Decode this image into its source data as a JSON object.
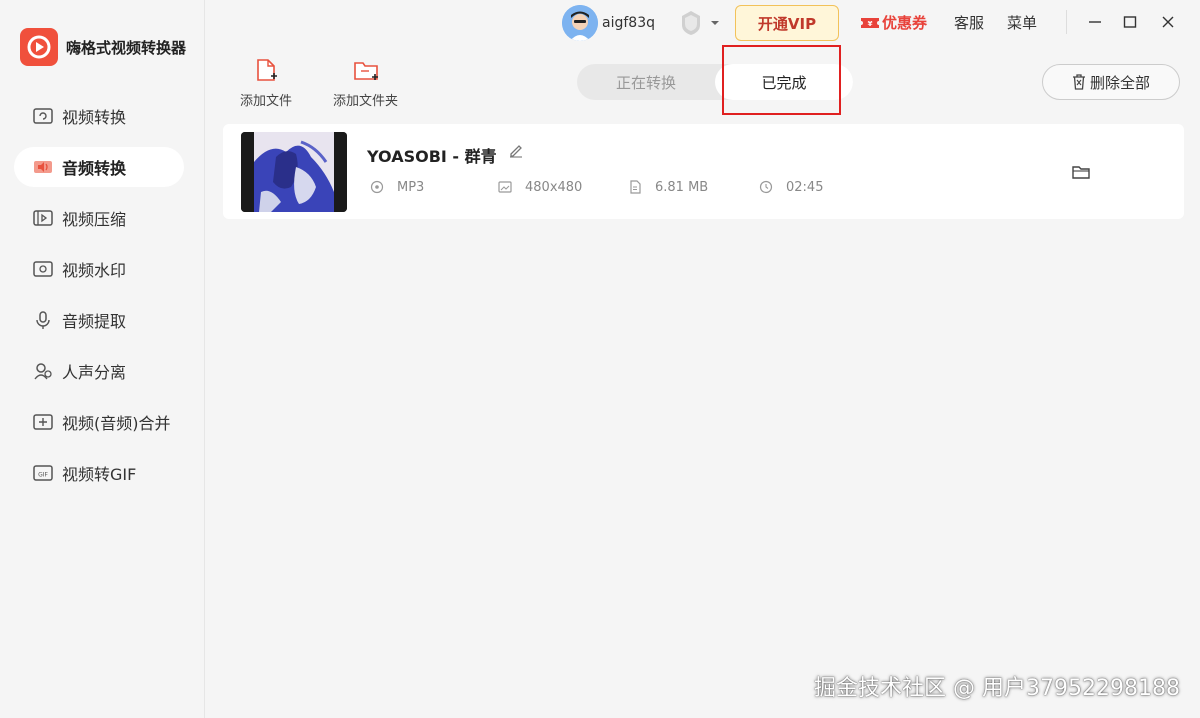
{
  "app": {
    "name": "嗨格式视频转换器",
    "accent_color": "#f0503c"
  },
  "sidebar": {
    "items": [
      {
        "label": "视频转换",
        "icon": "video-convert-icon"
      },
      {
        "label": "音频转换",
        "icon": "audio-convert-icon",
        "active": true
      },
      {
        "label": "视频压缩",
        "icon": "video-compress-icon"
      },
      {
        "label": "视频水印",
        "icon": "video-watermark-icon"
      },
      {
        "label": "音频提取",
        "icon": "audio-extract-icon"
      },
      {
        "label": "人声分离",
        "icon": "voice-separate-icon"
      },
      {
        "label": "视频(音频)合并",
        "icon": "merge-icon"
      },
      {
        "label": "视频转GIF",
        "icon": "gif-icon"
      }
    ]
  },
  "topbar": {
    "username": "aigf83q",
    "vip_label": "开通VIP",
    "coupon_label": "优惠券",
    "service_label": "客服",
    "menu_label": "菜单"
  },
  "toolbar": {
    "add_file_label": "添加文件",
    "add_folder_label": "添加文件夹",
    "delete_all_label": "删除全部"
  },
  "tabs": {
    "converting_label": "正在转换",
    "completed_label": "已完成",
    "active": "completed"
  },
  "files": [
    {
      "title": "YOASOBI - 群青",
      "format": "MP3",
      "resolution": "480x480",
      "size": "6.81 MB",
      "duration": "02:45"
    }
  ],
  "watermark": "掘金技术社区 @ 用户37952298188",
  "colors": {
    "highlight_box": "#e02020",
    "vip_bg": "#fff6d9",
    "coupon": "#e8423a"
  }
}
